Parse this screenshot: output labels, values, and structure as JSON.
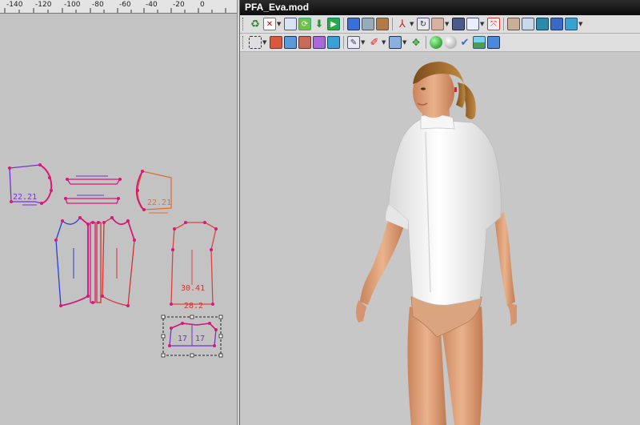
{
  "ruler": {
    "labels": [
      "-140",
      "-120",
      "-100",
      "-80",
      "-60",
      "-40",
      "-20",
      "0"
    ]
  },
  "window": {
    "title": "PFA_Eva.mod"
  },
  "pattern": {
    "measure_left_top": "22.21",
    "measure_right_top": "22.21",
    "measure_back_width": "30.41",
    "measure_back_lower": "28.2",
    "measure_collar_left": "17",
    "measure_collar_right": "17"
  },
  "toolbar1": {
    "icons": [
      "recycle-icon",
      "delete-icon",
      "import-icon",
      "refresh-icon",
      "download-arrow-icon",
      "play-icon",
      "fit-view-icon",
      "frame-icon",
      "texture-icon",
      "axes-icon",
      "rotate-view-icon",
      "avatar-icon",
      "screen-icon",
      "window-icon",
      "zoom-extents-icon",
      "camera-person-icon",
      "grid-view-icon",
      "panel-view-icon",
      "tile-view-icon",
      "monitor-icon"
    ]
  },
  "toolbar2": {
    "icons": [
      "select-box-icon",
      "image-icon",
      "layers-icon",
      "blocks-icon",
      "layers2-icon",
      "material-icon",
      "brush-icon",
      "pin-icon",
      "mesh-icon",
      "cursor-move-icon",
      "sphere-green-icon",
      "sphere-grey-icon",
      "check-icon",
      "landscape-icon",
      "screenshot-icon"
    ]
  },
  "colors": {
    "pattern_magenta": "#d8187a",
    "pattern_purple": "#7a2fd0",
    "pattern_orange": "#e07030",
    "pattern_blue": "#2a3fd8",
    "pattern_red": "#d83030",
    "viewport_bg": "#c7c7c7",
    "shirt": "#f4f4f4",
    "skin": "#e2a078"
  }
}
